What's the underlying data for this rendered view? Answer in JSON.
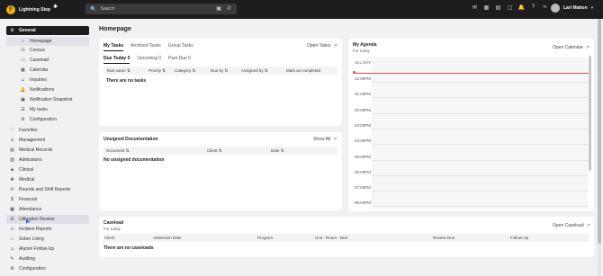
{
  "app": {
    "name": "Lightning Step",
    "logo_letter": "F",
    "star": "✱",
    "search_icon": "🔍",
    "search_placeholder": "Search",
    "search_right_icons": [
      "▣",
      "✆"
    ],
    "top_icons": [
      "✉",
      "▦",
      "▤",
      "▢",
      "🔔",
      "?",
      "∞"
    ],
    "user_name": "Lari Mahon",
    "user_caret": "▾"
  },
  "sidebar": {
    "items": [
      {
        "label": "General",
        "icon": "⚙",
        "type": "group-active"
      },
      {
        "label": "Homepage",
        "icon": "⌂",
        "type": "sub-selected"
      },
      {
        "label": "Census",
        "icon": "☷",
        "type": "sub"
      },
      {
        "label": "Caseload",
        "icon": "▭",
        "type": "sub"
      },
      {
        "label": "Calendar",
        "icon": "▦",
        "type": "sub"
      },
      {
        "label": "Inquiries",
        "icon": "☺",
        "type": "sub"
      },
      {
        "label": "Notifications",
        "icon": "🔔",
        "type": "sub"
      },
      {
        "label": "Notification Snapshot",
        "icon": "▣",
        "type": "sub"
      },
      {
        "label": "My tasks",
        "icon": "☰",
        "type": "sub"
      },
      {
        "label": "Configuration",
        "icon": "⚙",
        "type": "sub"
      },
      {
        "label": "Favorites",
        "icon": "♡",
        "type": "top"
      },
      {
        "label": "Management",
        "icon": "♙",
        "type": "top"
      },
      {
        "label": "Medical Records",
        "icon": "▤",
        "type": "top"
      },
      {
        "label": "Admissions",
        "icon": "▥",
        "type": "top"
      },
      {
        "label": "Clinical",
        "icon": "◈",
        "type": "top"
      },
      {
        "label": "Medical",
        "icon": "✚",
        "type": "top"
      },
      {
        "label": "Rounds and Shift Reports",
        "icon": "⟳",
        "type": "top"
      },
      {
        "label": "Financial",
        "icon": "$",
        "type": "top"
      },
      {
        "label": "Attendance",
        "icon": "▦",
        "type": "top"
      },
      {
        "label": "Utilization Review",
        "icon": "☰",
        "type": "top-highlight"
      },
      {
        "label": "Incident Reports",
        "icon": "⚠",
        "type": "top"
      },
      {
        "label": "Sober Living",
        "icon": "⌂",
        "type": "top"
      },
      {
        "label": "Alumni Follow-Up",
        "icon": "☺",
        "type": "top"
      },
      {
        "label": "Auditing",
        "icon": "✎",
        "type": "top"
      },
      {
        "label": "Configuration",
        "icon": "⚙",
        "type": "top"
      }
    ]
  },
  "page": {
    "title": "Homepage"
  },
  "tasks": {
    "tabs": [
      "My Tasks",
      "Archived Tasks",
      "Group Tasks"
    ],
    "open_link": "Open Tasks",
    "subtabs": [
      "Due Today 0",
      "Upcoming 0",
      "Past Due 0"
    ],
    "columns": [
      "Task name",
      "Priority",
      "Category",
      "Due by",
      "Assigned by",
      "Mark as completed"
    ],
    "empty": "There are no tasks"
  },
  "unsigned": {
    "title": "Unsigned Documentation",
    "link": "Show All",
    "columns": [
      "Document",
      "Client",
      "Date"
    ],
    "empty": "No unsigned documentation"
  },
  "agenda": {
    "title": "My Agenda",
    "subtitle": "For today",
    "link": "Open Calendar",
    "all_day": "ALL DAY",
    "times": [
      "12:00PM",
      "01:00PM",
      "02:00PM",
      "03:00PM",
      "04:00PM",
      "05:00PM",
      "06:00PM",
      "07:00PM",
      "08:00PM"
    ]
  },
  "caseload": {
    "title": "Caseload",
    "subtitle": "For today",
    "link": "Open Caseload",
    "columns": [
      "Client",
      "Admission Date",
      "Program",
      "Unit - Room - Bed",
      "Review Due",
      "Follow-Up"
    ],
    "empty": "There are no caseloads"
  },
  "icons": {
    "sort": "⇅",
    "external": "↗"
  }
}
